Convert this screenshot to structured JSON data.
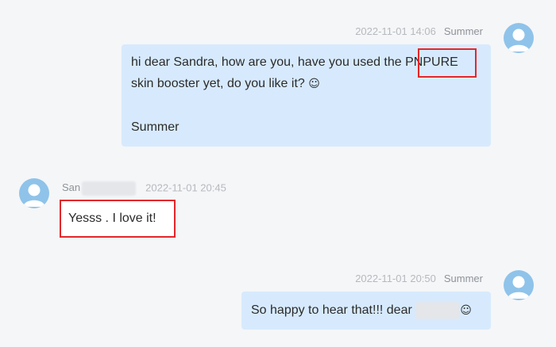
{
  "messages": [
    {
      "direction": "outgoing",
      "sender": "Summer",
      "timestamp": "2022-11-01 14:06",
      "lines": [
        "hi dear Sandra, how are you, have you used the ",
        "PNPURE",
        "skin booster yet, do you like it? ",
        "☺",
        "Summer"
      ],
      "highlighted": "PNPURE"
    },
    {
      "direction": "incoming",
      "sender_visible": "San",
      "timestamp": "2022-11-01 20:45",
      "text": "Yesss . I love it!",
      "highlighted": "Yesss . I love it!"
    },
    {
      "direction": "outgoing",
      "sender": "Summer",
      "timestamp": "2022-11-01 20:50",
      "text": "So happy to hear that!!! dear ",
      "emoji": "☺"
    }
  ],
  "colors": {
    "background": "#f5f6f8",
    "outgoing_bubble": "#d7eafd",
    "incoming_bubble": "#ffffff",
    "highlight_border": "#e4262a",
    "avatar": "#8fc3ea"
  },
  "icons": {
    "avatar": "user-avatar-icon",
    "emoji": "smiley-emoji-icon"
  }
}
